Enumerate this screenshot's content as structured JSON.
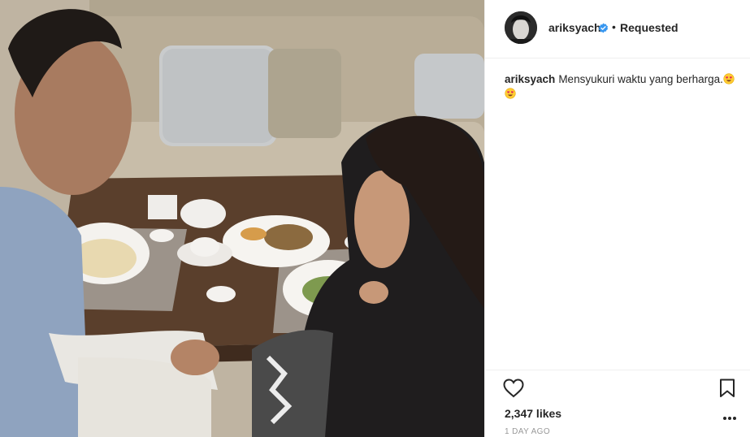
{
  "post": {
    "username": "ariksyach",
    "verified": true,
    "separator": "•",
    "follow_status": "Requested",
    "caption_username": "ariksyach",
    "caption_text": "Mensyukuri waktu yang berharga.",
    "caption_emojis": [
      "heart-eyes-emoji",
      "heart-eyes-emoji"
    ],
    "likes": "2,347 likes",
    "timestamp": "1 DAY AGO"
  },
  "icons": {
    "avatar": "profile-photo",
    "verified": "verified-badge-icon",
    "like": "heart-icon",
    "save": "bookmark-icon",
    "more": "more-options-icon"
  },
  "colors": {
    "verified_blue": "#3897f0",
    "text": "#262626",
    "muted": "#999999",
    "divider": "#efefef"
  }
}
